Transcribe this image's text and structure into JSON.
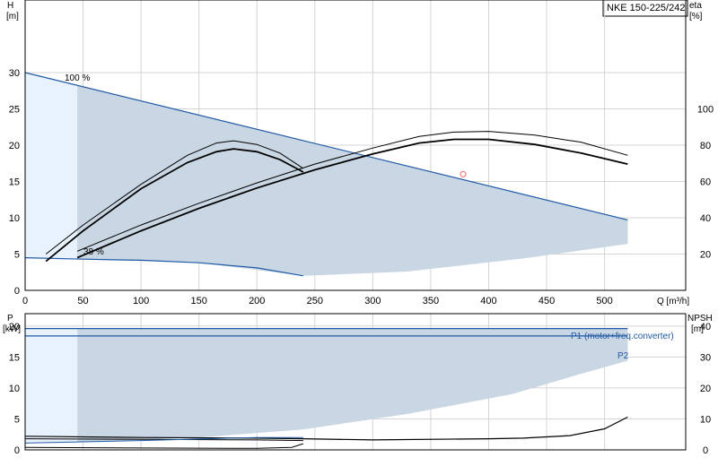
{
  "model": "NKE 150-225/242",
  "colors": {
    "region_fill": "#c9d6e3",
    "region_fill_light": "#e8f2fc",
    "blue_line": "#1f5aa6",
    "curve": "#000000",
    "marker": "#f08080"
  },
  "chart_data": [
    {
      "type": "line",
      "ylabel_left": [
        "H",
        "[m]"
      ],
      "ylabel_right": [
        "eta",
        "[%]"
      ],
      "xlabel": "Q [m³/h]",
      "xlim": [
        0,
        570
      ],
      "ylim": [
        0,
        40
      ],
      "y2lim": [
        0,
        160
      ],
      "x_ticks": [
        0,
        50,
        100,
        150,
        200,
        250,
        300,
        350,
        400,
        450,
        500
      ],
      "y_ticks": [
        0,
        5,
        10,
        15,
        20,
        25,
        30
      ],
      "y2_ticks": [
        20,
        40,
        60,
        80,
        100
      ],
      "grid": true,
      "speed_labels": [
        "100 %",
        "38 %"
      ],
      "operating_region": {
        "upper": [
          [
            0,
            30
          ],
          [
            45,
            28.2
          ],
          [
            520,
            9.7
          ]
        ],
        "lower": [
          [
            520,
            6.4
          ],
          [
            430,
            4.4
          ],
          [
            330,
            2.6
          ],
          [
            240,
            2.0
          ],
          [
            150,
            3.8
          ],
          [
            45,
            4.3
          ]
        ],
        "light_left": [
          [
            0,
            30
          ],
          [
            45,
            28.2
          ],
          [
            45,
            4.3
          ],
          [
            15,
            4.4
          ],
          [
            0,
            4.5
          ]
        ]
      },
      "series": [
        {
          "role": "max-speed-head",
          "color": "#1f5aa6",
          "width": 1.2,
          "points": [
            [
              0,
              30
            ],
            [
              520,
              9.7
            ]
          ]
        },
        {
          "role": "min-speed-head",
          "color": "#1f5aa6",
          "width": 1.2,
          "points": [
            [
              0,
              4.5
            ],
            [
              50,
              4.3
            ],
            [
              100,
              4.15
            ],
            [
              150,
              3.8
            ],
            [
              200,
              3.1
            ],
            [
              240,
              2.0
            ]
          ]
        },
        {
          "role": "efficiency-upper",
          "color": "#000000",
          "width": 1,
          "points": [
            [
              45,
              5.4
            ],
            [
              100,
              9.0
            ],
            [
              150,
              12.0
            ],
            [
              200,
              14.8
            ],
            [
              250,
              17.4
            ],
            [
              300,
              19.6
            ],
            [
              340,
              21.2
            ],
            [
              370,
              21.8
            ],
            [
              400,
              21.9
            ],
            [
              440,
              21.4
            ],
            [
              480,
              20.4
            ],
            [
              520,
              18.6
            ]
          ]
        },
        {
          "role": "efficiency-lower",
          "color": "#000000",
          "width": 1.8,
          "points": [
            [
              45,
              4.5
            ],
            [
              100,
              8.2
            ],
            [
              150,
              11.3
            ],
            [
              200,
              14.1
            ],
            [
              250,
              16.6
            ],
            [
              300,
              18.8
            ],
            [
              340,
              20.3
            ],
            [
              370,
              20.8
            ],
            [
              400,
              20.8
            ],
            [
              440,
              20.1
            ],
            [
              480,
              18.9
            ],
            [
              520,
              17.4
            ]
          ]
        },
        {
          "role": "part-load-upper",
          "color": "#000000",
          "width": 1,
          "points": [
            [
              18,
              5.0
            ],
            [
              50,
              9.0
            ],
            [
              100,
              14.6
            ],
            [
              140,
              18.6
            ],
            [
              165,
              20.3
            ],
            [
              180,
              20.6
            ],
            [
              200,
              20.1
            ],
            [
              220,
              18.9
            ],
            [
              240,
              16.8
            ]
          ]
        },
        {
          "role": "part-load-lower",
          "color": "#000000",
          "width": 1.8,
          "points": [
            [
              18,
              4.0
            ],
            [
              50,
              8.2
            ],
            [
              100,
              14.0
            ],
            [
              140,
              17.6
            ],
            [
              165,
              19.1
            ],
            [
              180,
              19.5
            ],
            [
              200,
              19.1
            ],
            [
              220,
              18.0
            ],
            [
              240,
              16.3
            ]
          ]
        }
      ],
      "duty_point": {
        "x": 378,
        "y": 16.0
      }
    },
    {
      "type": "line",
      "ylabel_left": [
        "P",
        "[kW]"
      ],
      "ylabel_right": [
        "NPSH",
        "[m]"
      ],
      "xlim": [
        0,
        570
      ],
      "ylim": [
        0,
        22
      ],
      "y2lim": [
        0,
        44
      ],
      "y_ticks": [
        0,
        5,
        10,
        15,
        20
      ],
      "y2_ticks": [
        0,
        10,
        20,
        30,
        40
      ],
      "grid": true,
      "annotations": [
        "P1 (motor+freq.converter)",
        "P2"
      ],
      "operating_region": {
        "upper": [
          [
            45,
            19.6
          ],
          [
            520,
            19.6
          ]
        ],
        "lower": [
          [
            520,
            14.4
          ],
          [
            480,
            12.3
          ],
          [
            420,
            9.0
          ],
          [
            330,
            5.8
          ],
          [
            240,
            3.3
          ],
          [
            150,
            2.0
          ],
          [
            45,
            1.2
          ]
        ],
        "light_left": [
          [
            0,
            19.6
          ],
          [
            45,
            19.6
          ],
          [
            45,
            1.1
          ],
          [
            0,
            1.1
          ]
        ]
      },
      "series": [
        {
          "role": "P1",
          "color": "#1f5aa6",
          "width": 1.2,
          "points": [
            [
              0,
              19.6
            ],
            [
              520,
              19.6
            ]
          ]
        },
        {
          "role": "P2",
          "color": "#1f5aa6",
          "width": 1.2,
          "points": [
            [
              0,
              18.4
            ],
            [
              520,
              18.4
            ]
          ]
        },
        {
          "role": "NPSH-max",
          "color": "#000000",
          "width": 1.2,
          "points": [
            [
              0,
              2.2
            ],
            [
              100,
              2.0
            ],
            [
              200,
              1.9
            ],
            [
              240,
              1.8
            ],
            [
              300,
              1.6
            ],
            [
              400,
              1.8
            ],
            [
              430,
              1.9
            ],
            [
              470,
              2.3
            ],
            [
              500,
              3.4
            ],
            [
              520,
              5.3
            ]
          ]
        },
        {
          "role": "NPSH-part",
          "color": "#000000",
          "width": 1,
          "points": [
            [
              0,
              1.8
            ],
            [
              100,
              1.7
            ],
            [
              200,
              1.6
            ],
            [
              240,
              1.5
            ]
          ]
        },
        {
          "role": "P-low",
          "color": "#1f5aa6",
          "width": 1,
          "points": [
            [
              0,
              1.1
            ],
            [
              100,
              1.5
            ],
            [
              200,
              2.0
            ],
            [
              240,
              2.0
            ]
          ]
        },
        {
          "role": "NPSH-low",
          "color": "#000000",
          "width": 1,
          "points": [
            [
              0,
              0.4
            ],
            [
              100,
              0.3
            ],
            [
              200,
              0.25
            ],
            [
              230,
              0.4
            ],
            [
              240,
              1.0
            ]
          ]
        }
      ]
    }
  ]
}
